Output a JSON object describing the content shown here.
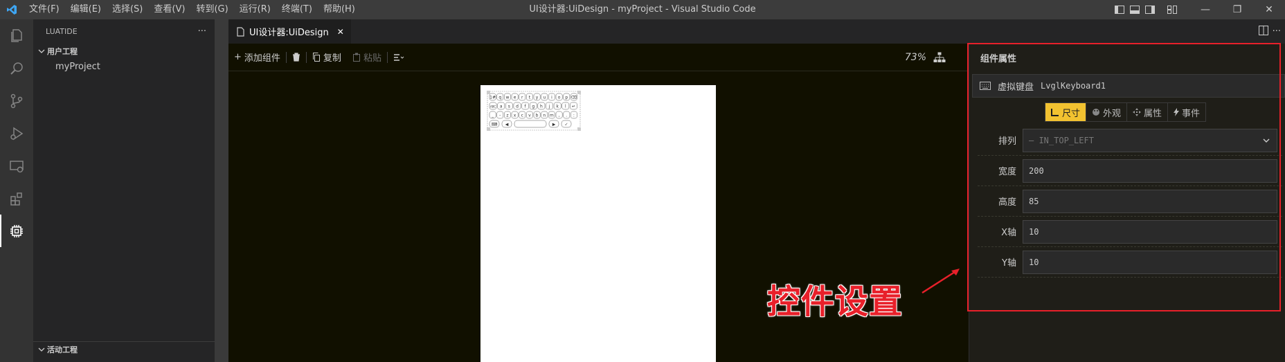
{
  "titlebar": {
    "menus": [
      "文件(F)",
      "编辑(E)",
      "选择(S)",
      "查看(V)",
      "转到(G)",
      "运行(R)",
      "终端(T)",
      "帮助(H)"
    ],
    "title": "UI设计器:UiDesign - myProject - Visual Studio Code"
  },
  "activitybar": {
    "icons": [
      "files-icon",
      "search-icon",
      "source-control-icon",
      "run-debug-icon",
      "remote-explorer-icon",
      "extensions-icon",
      "chip-icon"
    ]
  },
  "sidebar": {
    "header": "LUATIDE",
    "more": "···",
    "section_user": "用户工程",
    "project": "myProject",
    "section_active": "活动工程"
  },
  "editor": {
    "tab_label": "UI设计器:UiDesign",
    "tab_close": "✕"
  },
  "toolbar": {
    "add": "添加组件",
    "copy": "复制",
    "paste": "粘贴",
    "zoom": "73%"
  },
  "props": {
    "title": "组件属性",
    "component_type": "虚拟键盘",
    "component_name": "LvglKeyboard1",
    "tabs": [
      "尺寸",
      "外观",
      "属性",
      "事件"
    ],
    "active_tab": "尺寸",
    "rows": [
      {
        "label": "排列",
        "value": "— IN_TOP_LEFT"
      },
      {
        "label": "宽度",
        "value": "200"
      },
      {
        "label": "高度",
        "value": "85"
      },
      {
        "label": "X轴",
        "value": "10"
      },
      {
        "label": "Y轴",
        "value": "10"
      }
    ]
  },
  "annotation": {
    "text": "控件设置",
    "color": "#e8202a"
  },
  "keyboard": {
    "row1": [
      "1#",
      "q",
      "w",
      "e",
      "r",
      "t",
      "y",
      "u",
      "i",
      "o",
      "p",
      "⌫"
    ],
    "row2": [
      "ABC",
      "a",
      "s",
      "d",
      "f",
      "g",
      "h",
      "j",
      "k",
      "l",
      "↵"
    ],
    "row3": [
      "_",
      "-",
      "z",
      "x",
      "c",
      "v",
      "b",
      "n",
      "m",
      ",",
      ".",
      ":"
    ],
    "row4": [
      "⌨",
      "◀",
      "",
      "▶",
      "✓"
    ]
  }
}
